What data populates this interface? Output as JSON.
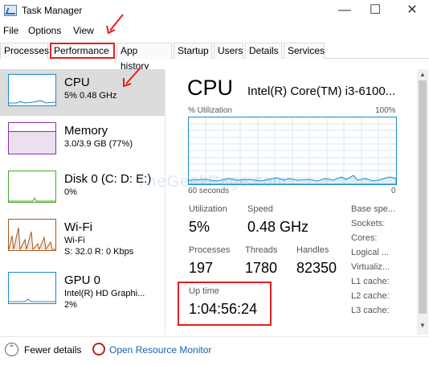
{
  "window": {
    "title": "Task Manager"
  },
  "menu": {
    "file": "File",
    "options": "Options",
    "view": "View"
  },
  "tabs": [
    "Processes",
    "Performance",
    "App history",
    "Startup",
    "Users",
    "Details",
    "Services"
  ],
  "sidebar": {
    "items": [
      {
        "name": "CPU",
        "line2": "5% 0.48 GHz",
        "line3": ""
      },
      {
        "name": "Memory",
        "line2": "3.0/3.9 GB (77%)",
        "line3": ""
      },
      {
        "name": "Disk 0 (C: D: E:)",
        "line2": "0%",
        "line3": ""
      },
      {
        "name": "Wi-Fi",
        "line2": "Wi-Fi",
        "line3": "S: 32.0  R: 0 Kbps"
      },
      {
        "name": "GPU 0",
        "line2": "Intel(R) HD Graphi...",
        "line3": "2%"
      }
    ]
  },
  "main": {
    "title": "CPU",
    "model": "Intel(R) Core(TM) i3-6100...",
    "graph": {
      "ylabel": "% Utilization",
      "ymax": "100%",
      "xlabel": "60 seconds",
      "xmin": "0"
    },
    "stats": {
      "utilization_label": "Utilization",
      "utilization": "5%",
      "speed_label": "Speed",
      "speed": "0.48 GHz",
      "processes_label": "Processes",
      "processes": "197",
      "threads_label": "Threads",
      "threads": "1780",
      "handles_label": "Handles",
      "handles": "82350",
      "uptime_label": "Up time",
      "uptime": "1:04:56:24"
    },
    "right_labels": [
      "Base spe...",
      "Sockets:",
      "Cores:",
      "Logical ...",
      "Virtualiz...",
      "L1 cache:",
      "L2 cache:",
      "L3 cache:"
    ]
  },
  "footer": {
    "fewer_details": "Fewer details",
    "open_monitor": "Open Resource Monitor"
  },
  "watermark": "TheGeekPage.com",
  "colors": {
    "cpu": "#1a8bc5",
    "memory": "#8b2fa8",
    "disk": "#4aa52e",
    "wifi": "#a7591a",
    "gpu": "#1a8bc5",
    "annotation": "#e02020"
  }
}
